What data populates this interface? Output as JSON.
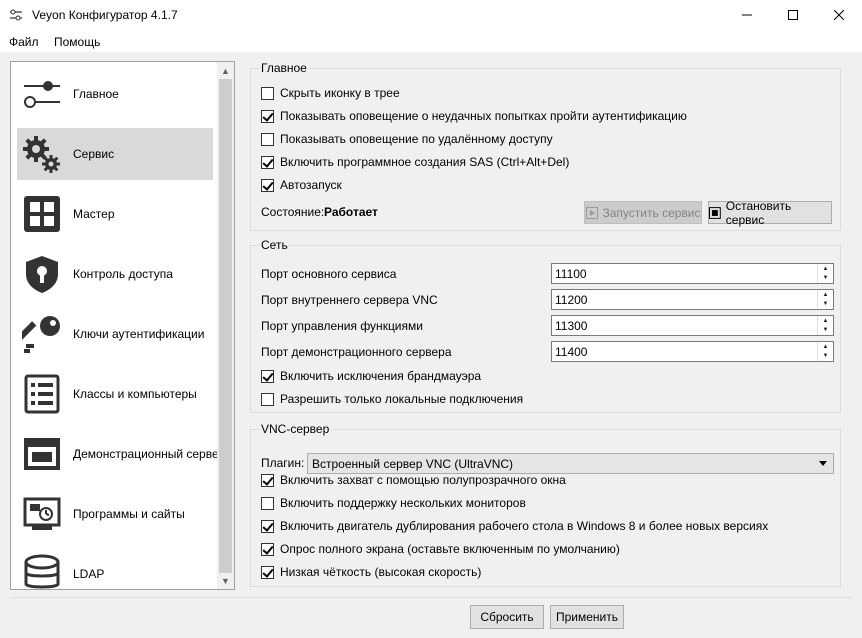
{
  "window": {
    "title": "Veyon Конфигуратор 4.1.7",
    "minimize_icon": "minimize-icon",
    "maximize_icon": "maximize-icon",
    "close_icon": "close-icon"
  },
  "menu": {
    "file": "Файл",
    "help": "Помощь"
  },
  "sidebar": {
    "items": [
      {
        "label": "Главное",
        "icon": "sliders-icon",
        "active": false
      },
      {
        "label": "Сервис",
        "icon": "gears-icon",
        "active": true
      },
      {
        "label": "Мастер",
        "icon": "master-grid-icon",
        "active": false
      },
      {
        "label": "Контроль доступа",
        "icon": "shield-lock-icon",
        "active": false
      },
      {
        "label": "Ключи аутентификации",
        "icon": "key-icon",
        "active": false
      },
      {
        "label": "Классы и компьютеры",
        "icon": "list-document-icon",
        "active": false
      },
      {
        "label": "Демонстрационный сервер",
        "icon": "demo-window-icon",
        "active": false
      },
      {
        "label": "Программы и сайты",
        "icon": "programs-sites-icon",
        "active": false
      },
      {
        "label": "LDAP",
        "icon": "database-icon",
        "active": false
      }
    ]
  },
  "general": {
    "title": "Главное",
    "hide_tray_icon": {
      "label": "Скрыть иконку в трее",
      "checked": false
    },
    "show_auth_fail": {
      "label": "Показывать оповещение о неудачных попытках пройти аутентификацию",
      "checked": true
    },
    "show_remote_access": {
      "label": "Показывать оповещение по удалённому доступу",
      "checked": false
    },
    "enable_sas": {
      "label": "Включить программное создания SAS (Ctrl+Alt+Del)",
      "checked": true
    },
    "autostart": {
      "label": "Автозапуск",
      "checked": true
    },
    "state_label": "Состояние:",
    "state_value": "Работает",
    "start_button": "Запустить сервис",
    "stop_button": "Остановить сервис"
  },
  "network": {
    "title": "Сеть",
    "ports": [
      {
        "label": "Порт основного сервиса",
        "value": "11100"
      },
      {
        "label": "Порт внутреннего сервера VNC",
        "value": "11200"
      },
      {
        "label": "Порт управления функциями",
        "value": "11300"
      },
      {
        "label": "Порт демонстрационного сервера",
        "value": "11400"
      }
    ],
    "firewall_exception": {
      "label": "Включить исключения брандмауэра",
      "checked": true
    },
    "local_only": {
      "label": "Разрешить только локальные подключения",
      "checked": false
    }
  },
  "vnc": {
    "title": "VNC-сервер",
    "plugin_label": "Плагин:",
    "plugin_value": "Встроенный сервер VNC (UltraVNC)",
    "options": [
      {
        "label": "Включить захват с помощью полупрозрачного окна",
        "checked": true
      },
      {
        "label": "Включить поддержку нескольких мониторов",
        "checked": false
      },
      {
        "label": "Включить двигатель дублирования рабочего стола в Windows 8 и более новых версиях",
        "checked": true
      },
      {
        "label": "Опрос полного экрана (оставьте включенным по умолчанию)",
        "checked": true
      },
      {
        "label": "Низкая чёткость (высокая скорость)",
        "checked": true
      }
    ]
  },
  "footer": {
    "reset_button": "Сбросить",
    "apply_button": "Применить"
  }
}
